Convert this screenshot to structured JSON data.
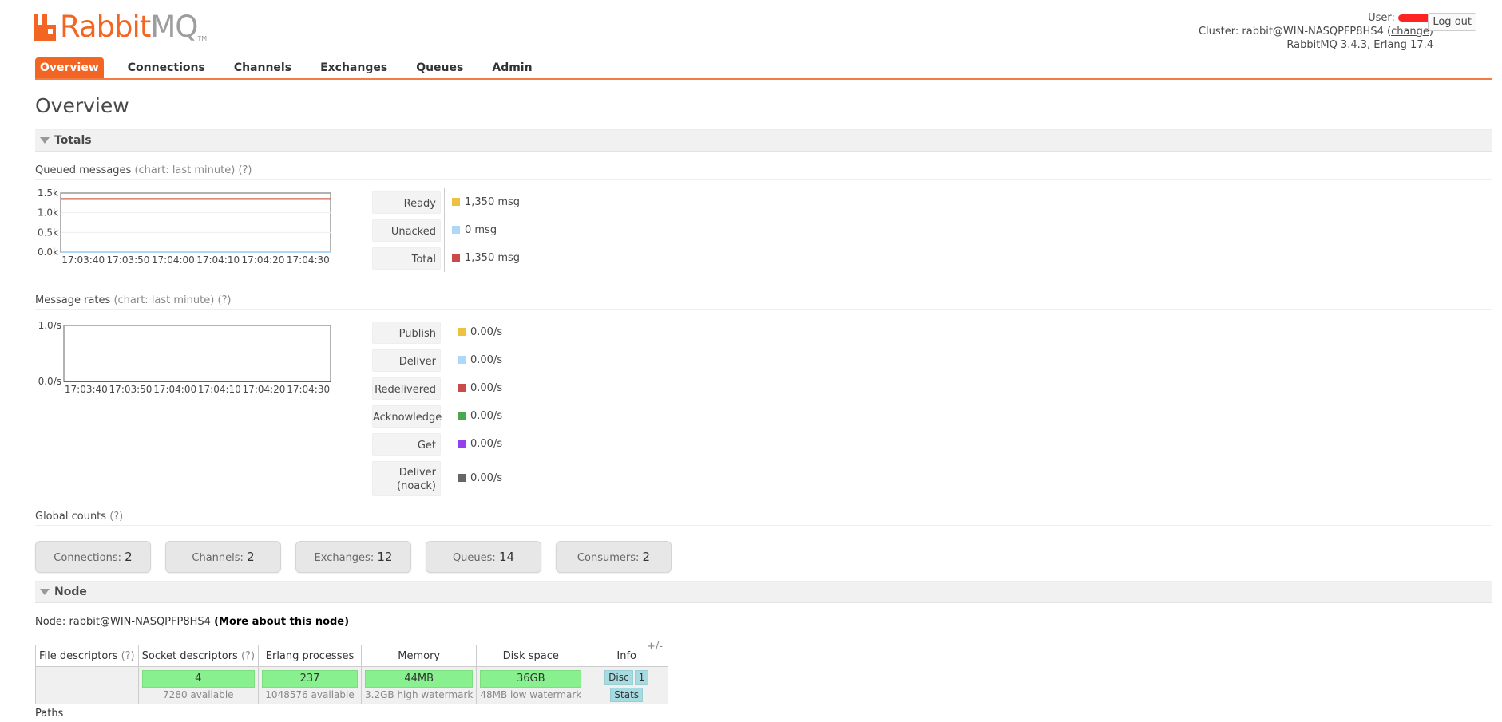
{
  "header": {
    "logo_word1": "Rabbit",
    "logo_word2": "MQ",
    "logo_tm": "TM",
    "user_label": "User:",
    "cluster_label": "Cluster:",
    "cluster_name": "rabbit@WIN-NASQPFP8HS4",
    "change_link": "change",
    "version_text": "RabbitMQ 3.4.3,",
    "erlang_link": "Erlang 17.4",
    "logout_label": "Log out"
  },
  "nav": {
    "tabs": [
      "Overview",
      "Connections",
      "Channels",
      "Exchanges",
      "Queues",
      "Admin"
    ],
    "active": "Overview"
  },
  "page_title": "Overview",
  "totals": {
    "section_label": "Totals",
    "queued": {
      "title": "Queued messages",
      "hint": "(chart: last minute) (?)",
      "legend": [
        {
          "label": "Ready",
          "value": "1,350 msg",
          "color": "#edc240"
        },
        {
          "label": "Unacked",
          "value": "0 msg",
          "color": "#afd8f8"
        },
        {
          "label": "Total",
          "value": "1,350 msg",
          "color": "#cb4b4b"
        }
      ]
    },
    "rates": {
      "title": "Message rates",
      "hint": "(chart: last minute) (?)",
      "legend": [
        {
          "label": "Publish",
          "value": "0.00/s",
          "color": "#edc240"
        },
        {
          "label": "Deliver",
          "value": "0.00/s",
          "color": "#afd8f8"
        },
        {
          "label": "Redelivered",
          "value": "0.00/s",
          "color": "#cb4b4b"
        },
        {
          "label": "Acknowledge",
          "value": "0.00/s",
          "color": "#4da74d"
        },
        {
          "label": "Get",
          "value": "0.00/s",
          "color": "#9440ed"
        },
        {
          "label": "Deliver (noack)",
          "value": "0.00/s",
          "color": "#666666"
        }
      ]
    },
    "global_counts": {
      "title": "Global counts",
      "hint": "(?)",
      "items": [
        {
          "label": "Connections:",
          "value": "2"
        },
        {
          "label": "Channels:",
          "value": "2"
        },
        {
          "label": "Exchanges:",
          "value": "12"
        },
        {
          "label": "Queues:",
          "value": "14"
        },
        {
          "label": "Consumers:",
          "value": "2"
        }
      ]
    }
  },
  "node": {
    "section_label": "Node",
    "node_prefix": "Node:",
    "node_name": "rabbit@WIN-NASQPFP8HS4",
    "more_link": "(More about this node)",
    "columns": [
      "File descriptors",
      "Socket descriptors",
      "Erlang processes",
      "Memory",
      "Disk space",
      "Info"
    ],
    "help_mark": "(?)",
    "plus_minus": "+/-",
    "socket_value": "4",
    "socket_sub": "7280 available",
    "erlang_value": "237",
    "erlang_sub": "1048576 available",
    "memory_value": "44MB",
    "memory_sub": "3.2GB high watermark",
    "disk_value": "36GB",
    "disk_sub": "48MB low watermark",
    "info_tags": [
      "Disc",
      "1",
      "Stats"
    ],
    "paths_label": "Paths"
  },
  "chart_data": [
    {
      "type": "line",
      "title": "Queued messages",
      "x": [
        "17:03:40",
        "17:03:50",
        "17:04:00",
        "17:04:10",
        "17:04:20",
        "17:04:30"
      ],
      "ylim": [
        0,
        1500
      ],
      "yticks": [
        "0.0k",
        "0.5k",
        "1.0k",
        "1.5k"
      ],
      "series": [
        {
          "name": "Ready",
          "values": [
            1350,
            1350,
            1350,
            1350,
            1350,
            1350,
            1350
          ]
        },
        {
          "name": "Unacked",
          "values": [
            0,
            0,
            0,
            0,
            0,
            0,
            0
          ]
        },
        {
          "name": "Total",
          "values": [
            1350,
            1350,
            1350,
            1350,
            1350,
            1350,
            1350
          ]
        }
      ]
    },
    {
      "type": "line",
      "title": "Message rates",
      "x": [
        "17:03:40",
        "17:03:50",
        "17:04:00",
        "17:04:10",
        "17:04:20",
        "17:04:30"
      ],
      "ylim": [
        0,
        1
      ],
      "yticks": [
        "0.0/s",
        "1.0/s"
      ],
      "series": [
        {
          "name": "Publish",
          "values": [
            0,
            0,
            0,
            0,
            0,
            0,
            0
          ]
        },
        {
          "name": "Deliver",
          "values": [
            0,
            0,
            0,
            0,
            0,
            0,
            0
          ]
        },
        {
          "name": "Redelivered",
          "values": [
            0,
            0,
            0,
            0,
            0,
            0,
            0
          ]
        },
        {
          "name": "Acknowledge",
          "values": [
            0,
            0,
            0,
            0,
            0,
            0,
            0
          ]
        },
        {
          "name": "Get",
          "values": [
            0,
            0,
            0,
            0,
            0,
            0,
            0
          ]
        },
        {
          "name": "Deliver (noack)",
          "values": [
            0,
            0,
            0,
            0,
            0,
            0,
            0
          ]
        }
      ]
    }
  ]
}
